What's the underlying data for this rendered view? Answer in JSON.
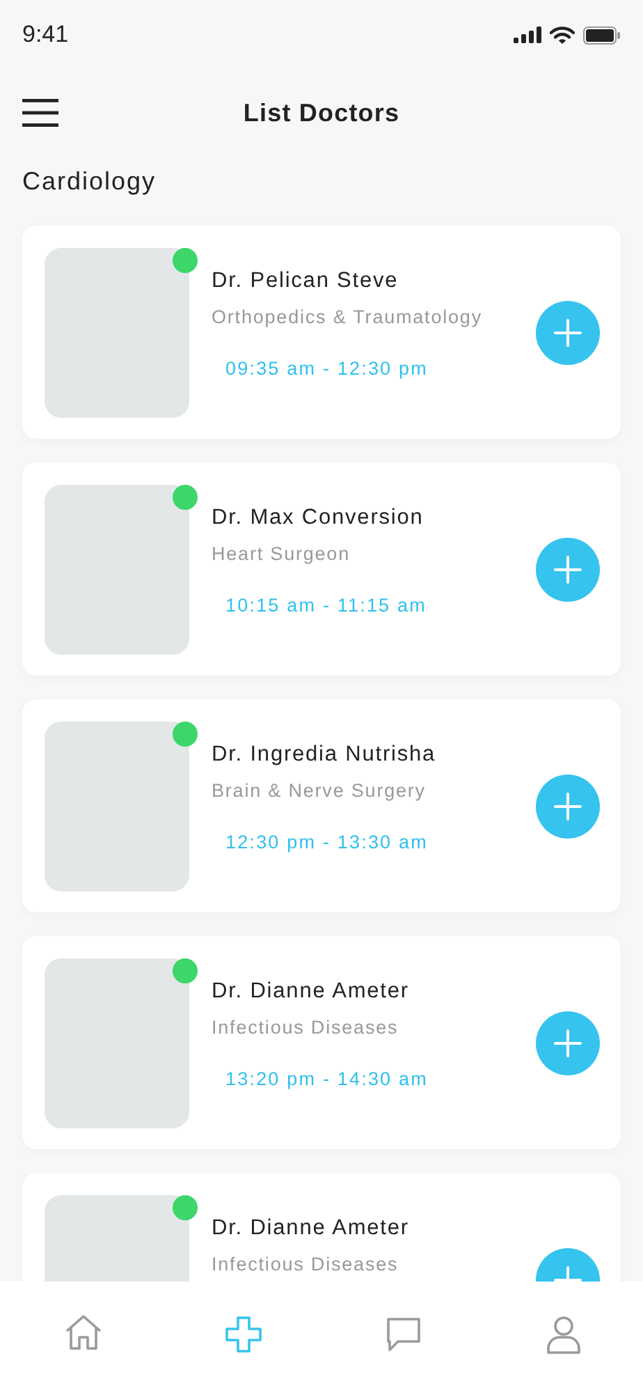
{
  "status_bar": {
    "time": "9:41"
  },
  "header": {
    "title": "List Doctors"
  },
  "section": {
    "title": "Cardiology"
  },
  "doctors": [
    {
      "name": "Dr. Pelican Steve",
      "specialty": "Orthopedics & Traumatology",
      "hours": "09:35 am - 12:30 pm",
      "online": true
    },
    {
      "name": "Dr. Max Conversion",
      "specialty": "Heart Surgeon",
      "hours": "10:15 am - 11:15 am",
      "online": true
    },
    {
      "name": "Dr. Ingredia Nutrisha",
      "specialty": "Brain & Nerve Surgery",
      "hours": "12:30 pm - 13:30 am",
      "online": true
    },
    {
      "name": "Dr. Dianne Ameter",
      "specialty": "Infectious Diseases",
      "hours": "13:20 pm - 14:30 am",
      "online": true
    },
    {
      "name": "Dr. Dianne Ameter",
      "specialty": "Infectious Diseases",
      "online": true
    }
  ],
  "nav": [
    {
      "kind": "home",
      "selected": false
    },
    {
      "kind": "add",
      "selected": true
    },
    {
      "kind": "chat",
      "selected": false
    },
    {
      "kind": "profile",
      "selected": false
    }
  ]
}
